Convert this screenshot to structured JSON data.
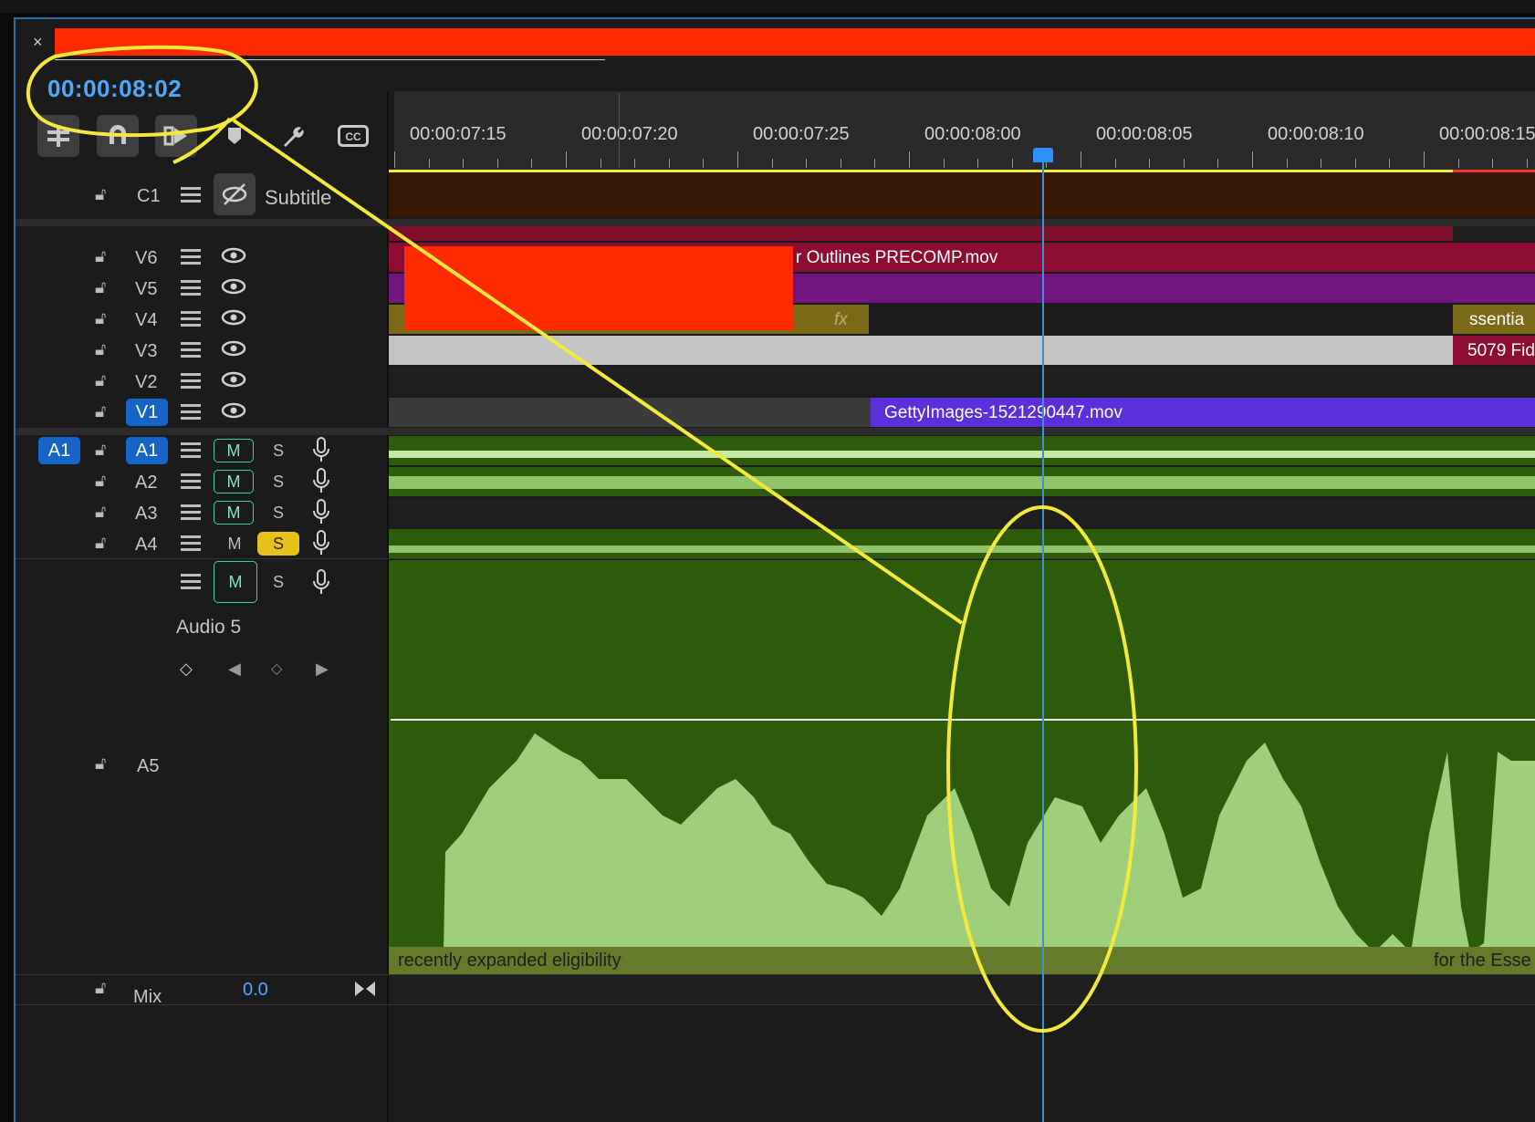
{
  "panel": {
    "close_glyph": "×",
    "tab_color": "#ff2a00",
    "timecode": "00:00:08:02"
  },
  "toolbar": {
    "tools": [
      {
        "name": "insert-tool-icon",
        "glyph": "⧉"
      },
      {
        "name": "snap-magnet-icon",
        "glyph": "∩"
      },
      {
        "name": "linked-selection-icon",
        "glyph": "⌁"
      },
      {
        "name": "add-marker-icon",
        "glyph": "⬟"
      },
      {
        "name": "wrench-settings-icon",
        "glyph": "🔧"
      },
      {
        "name": "captions-icon",
        "glyph": "CC"
      }
    ]
  },
  "ruler": {
    "labels": [
      "00:00:07:15",
      "00:00:07:20",
      "00:00:07:25",
      "00:00:08:00",
      "00:00:08:05",
      "00:00:08:10",
      "00:00:08:15"
    ]
  },
  "tracks": {
    "caption": {
      "label": "C1",
      "name": "Subtitle"
    },
    "video": [
      {
        "label": "V6"
      },
      {
        "label": "V5"
      },
      {
        "label": "V4"
      },
      {
        "label": "V3"
      },
      {
        "label": "V2"
      },
      {
        "label": "V1"
      }
    ],
    "audio": [
      {
        "label": "A1",
        "source": "A1",
        "mute": "M",
        "solo": "S"
      },
      {
        "label": "A2",
        "mute": "M",
        "solo": "S"
      },
      {
        "label": "A3",
        "mute": "M",
        "solo": "S"
      },
      {
        "label": "A4",
        "mute": "M",
        "solo": "S"
      }
    ],
    "a5": {
      "label": "A5",
      "name": "Audio 5",
      "mute": "M",
      "solo": "S"
    },
    "mix": {
      "label": "Mix",
      "value": "0.0"
    }
  },
  "clips": {
    "v6": "r Outlines PRECOMP.mov",
    "v4_fx": "fx",
    "v4_right": "ssentia",
    "v3_right": "5079 Fid",
    "v1": "GettyImages-1521290447.mov",
    "a5_caption_left": "recently expanded eligibility",
    "a5_caption_right": "for the Esse"
  },
  "colors": {
    "accent_blue": "#4fa8ff",
    "playhead": "#3f8fd8",
    "annotation_yellow": "#f2e93a",
    "audio_clip": "#2e5a0c",
    "waveform": "#9fcf7a"
  }
}
